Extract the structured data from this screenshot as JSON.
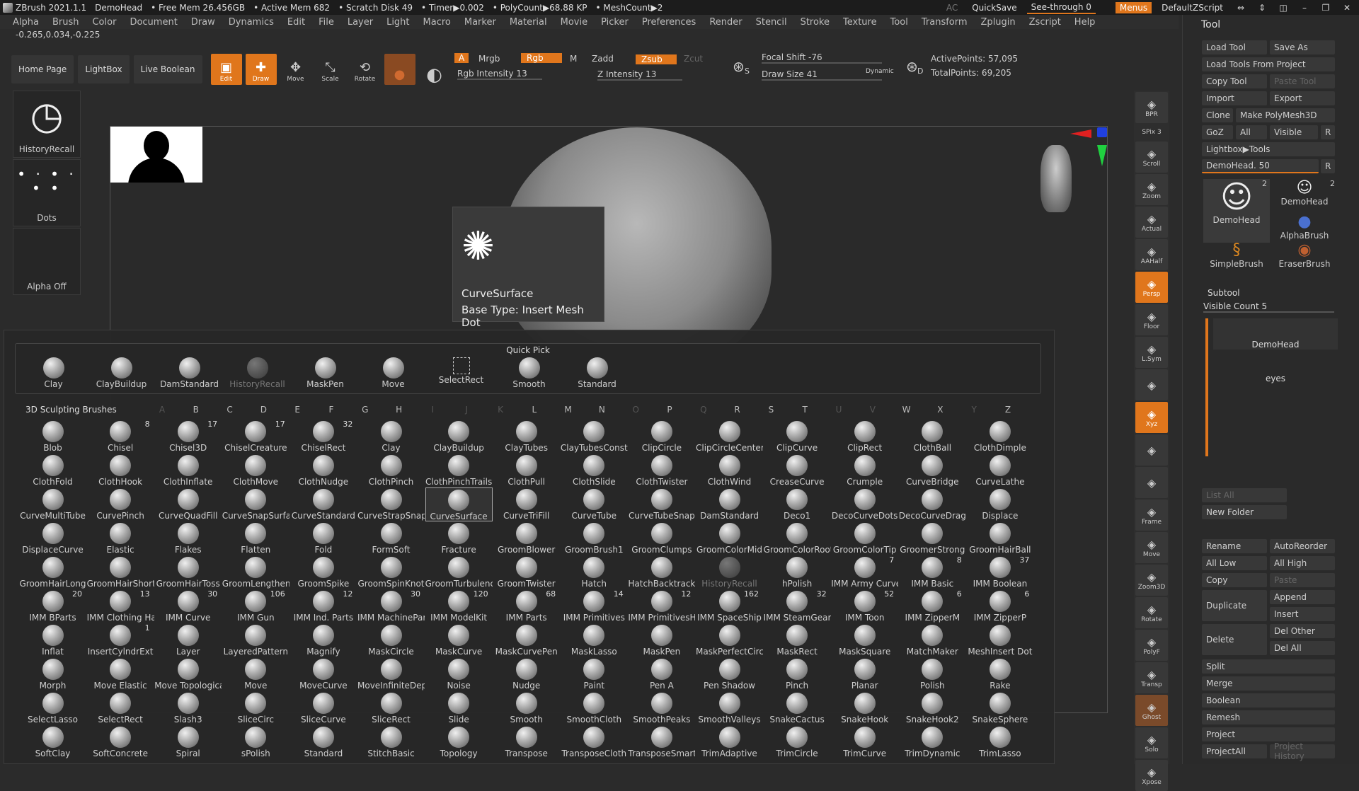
{
  "titlebar": {
    "app": "ZBrush 2021.1.1",
    "doc": "DemoHead",
    "free_mem": "• Free Mem 26.456GB",
    "active_mem": "• Active Mem 682",
    "scratch": "• Scratch Disk 49",
    "timer": "• Timer▶0.002",
    "polycount": "• PolyCount▶68.88 KP",
    "meshcount": "• MeshCount▶2",
    "ac": "AC",
    "quicksave": "QuickSave",
    "seethrough": "See-through  0",
    "menus": "Menus",
    "script": "DefaultZScript"
  },
  "menu": [
    "Alpha",
    "Brush",
    "Color",
    "Document",
    "Draw",
    "Dynamics",
    "Edit",
    "File",
    "Layer",
    "Light",
    "Macro",
    "Marker",
    "Material",
    "Movie",
    "Picker",
    "Preferences",
    "Render",
    "Stencil",
    "Stroke",
    "Texture",
    "Tool",
    "Transform",
    "Zplugin",
    "Zscript",
    "Help"
  ],
  "coords": "-0.265,0.034,-0.225",
  "toolbar": {
    "home": "Home Page",
    "lightbox": "LightBox",
    "live_boolean": "Live Boolean",
    "edit": "Edit",
    "draw": "Draw",
    "move": "Move",
    "scale": "Scale",
    "rotate": "Rotate",
    "a": "A",
    "mrgb": "Mrgb",
    "rgb": "Rgb",
    "m": "M",
    "zadd": "Zadd",
    "zsub": "Zsub",
    "zcut": "Zcut",
    "rgb_intensity": "Rgb Intensity 13",
    "z_intensity": "Z Intensity 13",
    "focal_shift": "Focal Shift -76",
    "draw_size": "Draw Size 41",
    "dynamic": "Dynamic",
    "active_points": "ActivePoints: 57,095",
    "total_points": "TotalPoints: 69,205",
    "s": "S",
    "d": "D"
  },
  "left_panel": {
    "history": "HistoryRecall",
    "dots": "Dots",
    "alpha": "Alpha Off"
  },
  "tooltip": {
    "name": "CurveSurface",
    "type": "Base Type: Insert Mesh Dot"
  },
  "quick_pick": {
    "title": "Quick Pick",
    "items": [
      "Clay",
      "ClayBuildup",
      "DamStandard",
      "HistoryRecall",
      "MaskPen",
      "Move",
      "SelectRect",
      "Smooth",
      "Standard"
    ]
  },
  "brushes_title": "3D Sculpting Brushes",
  "letters": [
    "A",
    "B",
    "C",
    "D",
    "E",
    "F",
    "G",
    "H",
    "I",
    "J",
    "K",
    "L",
    "M",
    "N",
    "O",
    "P",
    "Q",
    "R",
    "S",
    "T",
    "U",
    "V",
    "W",
    "X",
    "Y",
    "Z"
  ],
  "brush_rows": [
    [
      "Blob",
      "Chisel",
      "Chisel3D",
      "ChiselCreature",
      "ChiselRect",
      "Clay",
      "ClayBuildup",
      "ClayTubes",
      "ClayTubesConst",
      "ClipCircle",
      "ClipCircleCenter",
      "ClipCurve",
      "ClipRect",
      "ClothBall",
      "ClothDimple"
    ],
    [
      "ClothFold",
      "ClothHook",
      "ClothInflate",
      "ClothMove",
      "ClothNudge",
      "ClothPinch",
      "ClothPinchTrails",
      "ClothPull",
      "ClothSlide",
      "ClothTwister",
      "ClothWind",
      "CreaseCurve",
      "Crumple",
      "CurveBridge",
      "CurveLathe"
    ],
    [
      "CurveMultiTube",
      "CurvePinch",
      "CurveQuadFill",
      "CurveSnapSurfa",
      "CurveStandard",
      "CurveStrapSnap",
      "CurveSurface",
      "CurveTriFill",
      "CurveTube",
      "CurveTubeSnap",
      "DamStandard",
      "Deco1",
      "DecoCurveDots",
      "DecoCurveDragl",
      "Displace"
    ],
    [
      "DisplaceCurve",
      "Elastic",
      "Flakes",
      "Flatten",
      "Fold",
      "FormSoft",
      "Fracture",
      "GroomBlower",
      "GroomBrush1",
      "GroomClumps",
      "GroomColorMid",
      "GroomColorRoot",
      "GroomColorTip",
      "GroomerStrong",
      "GroomHairBall"
    ],
    [
      "GroomHairLong",
      "GroomHairShort",
      "GroomHairToss",
      "GroomLengthen",
      "GroomSpike",
      "GroomSpinKnot",
      "GroomTurbulenc",
      "GroomTwister",
      "Hatch",
      "HatchBacktrack",
      "HistoryRecall",
      "hPolish",
      "IMM Army Curve",
      "IMM Basic",
      "IMM Boolean"
    ],
    [
      "IMM BParts",
      "IMM Clothing Ha",
      "IMM Curve",
      "IMM Gun",
      "IMM Ind. Parts",
      "IMM MachinePar",
      "IMM ModelKit",
      "IMM Parts",
      "IMM Primitives",
      "IMM PrimitivesH",
      "IMM SpaceShip",
      "IMM SteamGear",
      "IMM Toon",
      "IMM ZipperM",
      "IMM ZipperP"
    ],
    [
      "Inflat",
      "InsertCylndrExt",
      "Layer",
      "LayeredPattern",
      "Magnify",
      "MaskCircle",
      "MaskCurve",
      "MaskCurvePen",
      "MaskLasso",
      "MaskPen",
      "MaskPerfectCirc",
      "MaskRect",
      "MaskSquare",
      "MatchMaker",
      "MeshInsert Dot"
    ],
    [
      "Morph",
      "Move Elastic",
      "Move Topologica",
      "Move",
      "MoveCurve",
      "MoveInfiniteDep",
      "Noise",
      "Nudge",
      "Paint",
      "Pen A",
      "Pen Shadow",
      "Pinch",
      "Planar",
      "Polish",
      "Rake"
    ],
    [
      "SelectLasso",
      "SelectRect",
      "Slash3",
      "SliceCirc",
      "SliceCurve",
      "SliceRect",
      "Slide",
      "Smooth",
      "SmoothCloth",
      "SmoothPeaks",
      "SmoothValleys",
      "SnakeCactus",
      "SnakeHook",
      "SnakeHook2",
      "SnakeSphere"
    ],
    [
      "SoftClay",
      "SoftConcrete",
      "Spiral",
      "sPolish",
      "Standard",
      "StitchBasic",
      "Topology",
      "Transpose",
      "TransposeCloth",
      "TransposeSmart",
      "TrimAdaptive",
      "TrimCircle",
      "TrimCurve",
      "TrimDynamic",
      "TrimLasso"
    ]
  ],
  "brush_counts": {
    "0_1": "8",
    "0_2": "17",
    "0_3": "17",
    "0_4": "32",
    "4_12": "7",
    "4_13": "8",
    "4_14": "37",
    "5_0": "20",
    "5_1": "13",
    "5_2": "30",
    "5_3": "106",
    "5_4": "12",
    "5_5": "30",
    "5_6": "120",
    "5_7": "68",
    "5_8": "14",
    "5_9": "12",
    "5_10": "162",
    "5_11": "32",
    "5_12": "52",
    "5_13": "6",
    "5_14": "6",
    "6_1": "1"
  },
  "shelf": [
    "BPR",
    "SPix 3",
    "Scroll",
    "Zoom",
    "Actual",
    "AAHalf",
    "Persp",
    "Floor",
    "L.Sym",
    "",
    "Xyz",
    "",
    "",
    "Frame",
    "Move",
    "Zoom3D",
    "Rotate",
    "PolyF",
    "Transp",
    "Ghost",
    "Solo",
    "Xpose"
  ],
  "tool_panel": {
    "title": "Tool",
    "load_tool": "Load Tool",
    "save_as": "Save As",
    "load_from_project": "Load Tools From Project",
    "copy_tool": "Copy Tool",
    "paste_tool": "Paste Tool",
    "import": "Import",
    "export": "Export",
    "clone": "Clone",
    "make_polymesh": "Make PolyMesh3D",
    "goz": "GoZ",
    "all": "All",
    "visible": "Visible",
    "r": "R",
    "lightbox_tools": "Lightbox▶Tools",
    "demohead_slider": "DemoHead. 50",
    "thumbs": [
      "DemoHead",
      "DemoHead",
      "AlphaBrush",
      "SimpleBrush",
      "EraserBrush"
    ],
    "thumb_count": "2",
    "subtool": "Subtool",
    "visible_count": "Visible Count 5",
    "subtool_items": [
      "DemoHead",
      "eyes"
    ],
    "list_all": "List All",
    "new_folder": "New Folder",
    "rename": "Rename",
    "auto_reorder": "AutoReorder",
    "all_low": "All Low",
    "all_high": "All High",
    "copy": "Copy",
    "paste": "Paste",
    "duplicate": "Duplicate",
    "append": "Append",
    "insert": "Insert",
    "delete": "Delete",
    "del_other": "Del Other",
    "del_all": "Del All",
    "split": "Split",
    "merge": "Merge",
    "boolean": "Boolean",
    "remesh": "Remesh",
    "project": "Project",
    "project_all": "ProjectAll",
    "project_history": "Project History"
  },
  "colors": {
    "accent": "#e0761c",
    "panel": "#2a2a2a",
    "bg": "#1c1c1c"
  }
}
